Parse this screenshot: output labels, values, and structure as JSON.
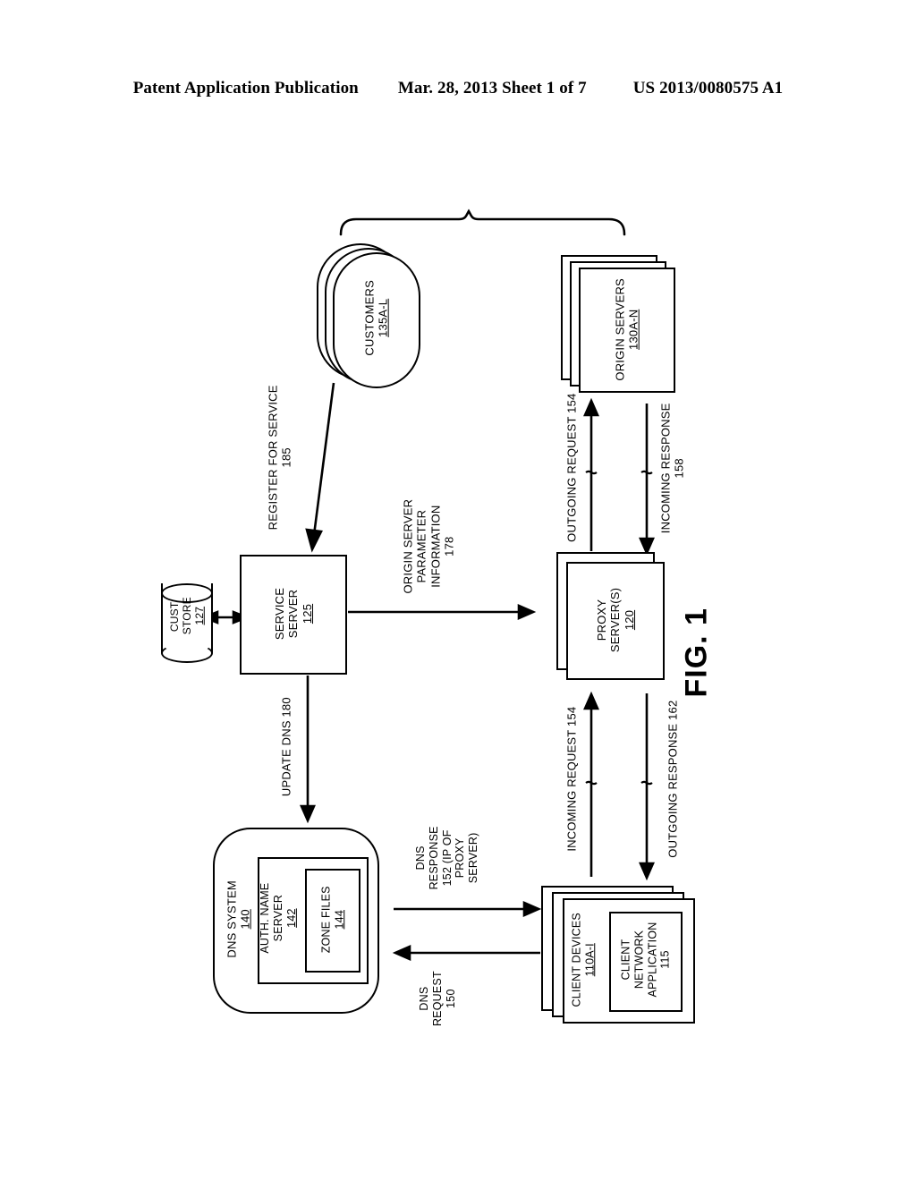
{
  "header": {
    "left": "Patent Application Publication",
    "middle": "Mar. 28, 2013  Sheet 1 of 7",
    "right": "US 2013/0080575 A1"
  },
  "figure": {
    "label": "FIG. 1"
  },
  "nodes": {
    "customers": {
      "title": "CUSTOMERS",
      "ref": "135A-L"
    },
    "origin_servers": {
      "title": "ORIGIN  SERVERS",
      "ref": "130A-N"
    },
    "cust_store": {
      "line1": "CUST.",
      "line2": "STORE",
      "ref": "127"
    },
    "service_server": {
      "line1": "SERVICE",
      "line2": "SERVER",
      "ref": "125"
    },
    "proxy_servers": {
      "line1": "PROXY",
      "line2": "SERVER(S)",
      "ref": "120"
    },
    "dns_system": {
      "title": "DNS SYSTEM",
      "ref": "140"
    },
    "auth_name_server": {
      "line1": "AUTH. NAME",
      "line2": "SERVER",
      "ref": "142"
    },
    "zone_files": {
      "title": "ZONE FILES",
      "ref": "144"
    },
    "client_devices": {
      "title": "CLIENT DEVICES",
      "ref": "110A-I"
    },
    "client_network_application": {
      "line1": "CLIENT",
      "line2": "NETWORK",
      "line3": "APPLICATION",
      "ref": "115"
    }
  },
  "edges": {
    "register_for_service": {
      "text": "REGISTER FOR SERVICE",
      "ref": "185"
    },
    "origin_server_parameter_information": {
      "line1": "ORIGIN SERVER",
      "line2": "PARAMETER",
      "line3": "INFORMATION",
      "ref": "178"
    },
    "update_dns": {
      "text": "UPDATE DNS 180"
    },
    "outgoing_request": {
      "text": "OUTGOING REQUEST 154"
    },
    "incoming_response": {
      "text": "INCOMING RESPONSE",
      "ref": "158"
    },
    "incoming_request": {
      "text": "INCOMING REQUEST 154"
    },
    "outgoing_response": {
      "text": "OUTGOING RESPONSE 162"
    },
    "dns_response": {
      "line1": "DNS",
      "line2": "RESPONSE",
      "line3": "152 (IP OF",
      "line4": "PROXY",
      "line5": "SERVER)"
    },
    "dns_request": {
      "line1": "DNS",
      "line2": "REQUEST",
      "line3": "150"
    }
  },
  "colors": {
    "ink": "#000000",
    "paper": "#ffffff"
  }
}
